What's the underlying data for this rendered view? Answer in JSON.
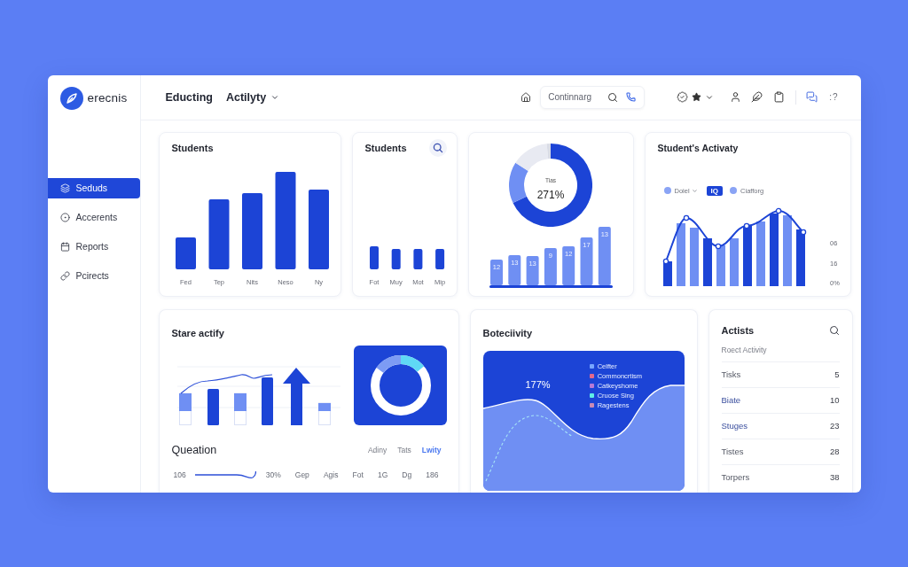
{
  "sidebar": {
    "logo_text": "erecnis",
    "items": [
      {
        "label": "Seduds",
        "selected": true
      },
      {
        "label": "Accerents",
        "selected": false
      },
      {
        "label": "Reports",
        "selected": false
      },
      {
        "label": "Pcirects",
        "selected": false
      }
    ]
  },
  "header": {
    "title": "Educting",
    "menu": "Actilyty",
    "search": {
      "placeholder": "Continnarg"
    },
    "help_text": ":?"
  },
  "students_card": {
    "title": "Students",
    "axis_labels": [
      "Fed",
      "Tep",
      "Nits",
      "Neso",
      "Ny"
    ]
  },
  "students_mini_card": {
    "title": "Students",
    "axis_labels": [
      "Fot",
      "Muy",
      "Mot",
      "Mip"
    ]
  },
  "overview_card": {
    "donut": {
      "label": "Tias",
      "value": "271%"
    },
    "bar_labels": [
      "12",
      "13",
      "13",
      "9",
      "12",
      "17",
      "13"
    ]
  },
  "activity_card": {
    "title": "Student's Activaty",
    "legend": [
      {
        "kind": "dropdown",
        "label": "Doiel"
      },
      {
        "kind": "badge",
        "label": "IQ"
      },
      {
        "kind": "dot",
        "label": "Ciafforg"
      }
    ],
    "axis_labels": [
      "06",
      "16",
      "0%"
    ]
  },
  "stare_card": {
    "title": "Stare actify",
    "question": {
      "title": "Queation",
      "tabs": [
        {
          "label": "Adiny",
          "selected": false
        },
        {
          "label": "Tats",
          "selected": false
        },
        {
          "label": "Lwity",
          "selected": true
        }
      ],
      "lead": "106",
      "cells": [
        "30%",
        "Gep",
        "Agis",
        "Fot",
        "1G",
        "Dg",
        "186"
      ]
    }
  },
  "selectivity_card": {
    "title": "Boteciivity",
    "value": "177%",
    "legend": [
      {
        "label": "Celfter",
        "color": "#78a6ff"
      },
      {
        "label": "Commoncrtism",
        "color": "#e3698c"
      },
      {
        "label": "Catkeyshome",
        "color": "#b77ad6"
      },
      {
        "label": "Cruose Sing",
        "color": "#5feee6"
      },
      {
        "label": "Ragestens",
        "color": "#c98ab5"
      }
    ]
  },
  "actists_card": {
    "title": "Actists",
    "subtitle": "Roect Activity",
    "rows": [
      {
        "label": "Tisks",
        "value": "5",
        "highlighted": false
      },
      {
        "label": "Biate",
        "value": "10",
        "highlighted": true
      },
      {
        "label": "Stuges",
        "value": "23",
        "highlighted": true
      },
      {
        "label": "Tistes",
        "value": "28",
        "highlighted": false
      },
      {
        "label": "Torpers",
        "value": "38",
        "highlighted": false
      }
    ]
  }
}
